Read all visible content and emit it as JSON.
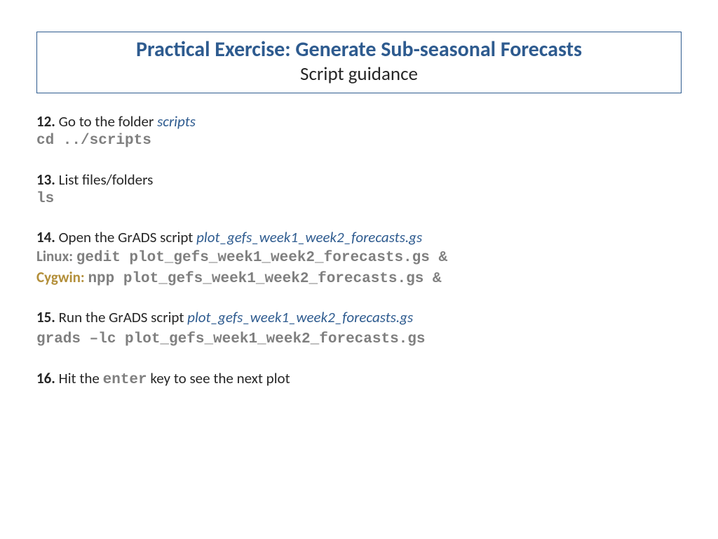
{
  "header": {
    "title": "Practical Exercise: Generate Sub-seasonal Forecasts",
    "subtitle": "Script guidance"
  },
  "steps": {
    "s12": {
      "num": "12.",
      "text": " Go to the folder ",
      "folder": "scripts",
      "cmd": "cd ../scripts"
    },
    "s13": {
      "num": "13.",
      "text": " List files/folders",
      "cmd": "ls"
    },
    "s14": {
      "num": "14.",
      "text": " Open the GrADS script ",
      "script": "plot_gefs_week1_week2_forecasts.gs",
      "linux_label": "Linux",
      "linux_cmd": "gedit plot_gefs_week1_week2_forecasts.gs &",
      "cygwin_label": "Cygwin",
      "cygwin_cmd": "npp plot_gefs_week1_week2_forecasts.gs &"
    },
    "s15": {
      "num": "15.",
      "text": " Run the GrADS script ",
      "script": "plot_gefs_week1_week2_forecasts.gs",
      "cmd": "grads –lc plot_gefs_week1_week2_forecasts.gs"
    },
    "s16": {
      "num": "16.",
      "text_a": " Hit the ",
      "key": "enter",
      "text_b": " key to see the next plot"
    }
  }
}
